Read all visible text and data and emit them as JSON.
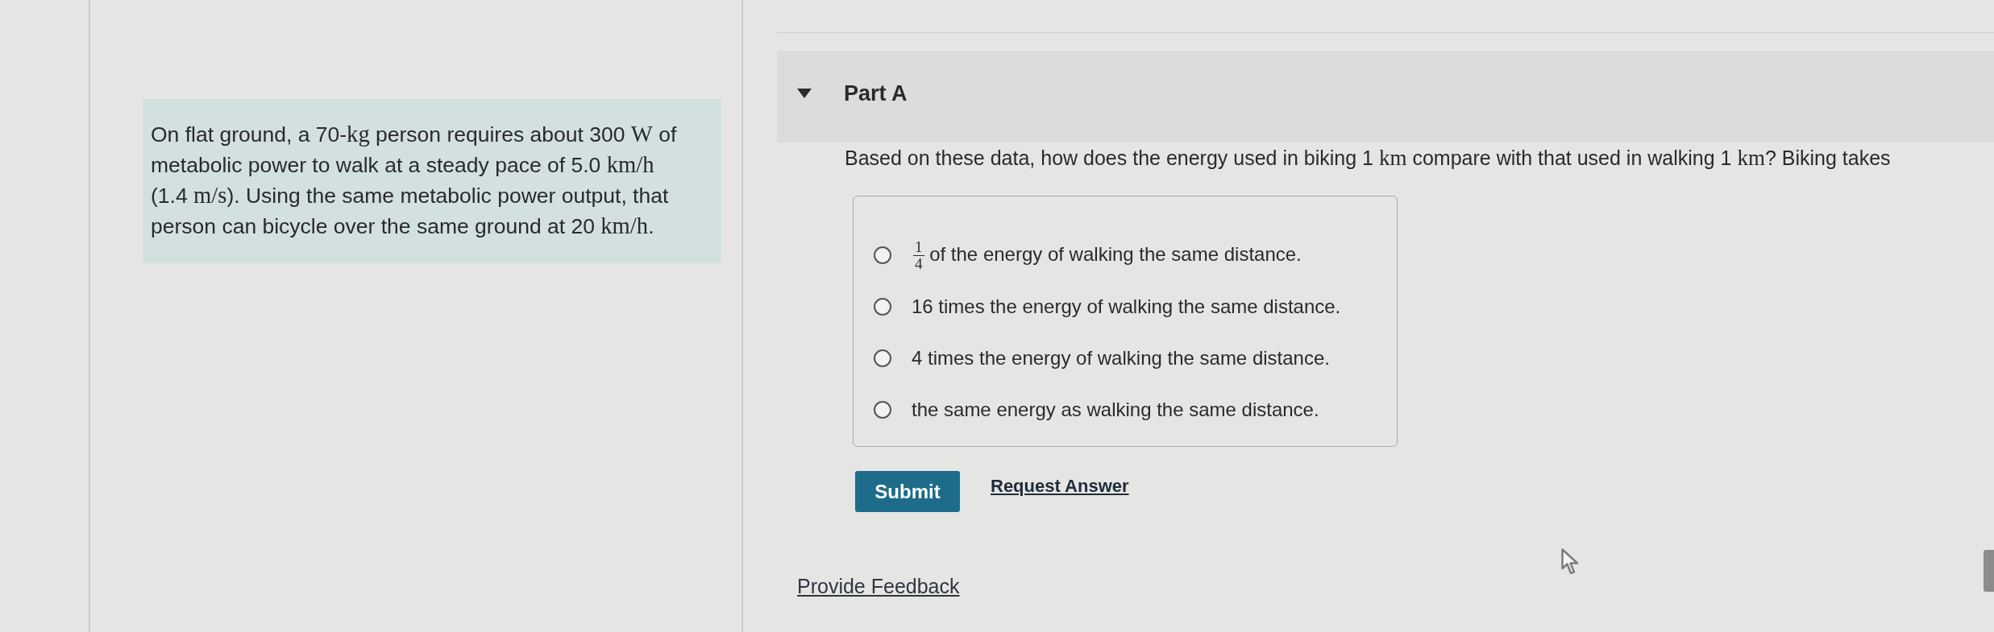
{
  "problem": {
    "segments": [
      {
        "kind": "text",
        "text": "On flat ground, a 70-"
      },
      {
        "kind": "math",
        "text": "kg"
      },
      {
        "kind": "text",
        "text": " person requires about 300 "
      },
      {
        "kind": "math",
        "text": "W"
      },
      {
        "kind": "text",
        "text": " of metabolic power to walk at a steady pace of 5.0 "
      },
      {
        "kind": "math",
        "text": "km/h"
      },
      {
        "kind": "text",
        "text": " (1.4 "
      },
      {
        "kind": "math",
        "text": "m/s"
      },
      {
        "kind": "text",
        "text": "). Using the same metabolic power output, that person can bicycle over the same ground at 20 "
      },
      {
        "kind": "math",
        "text": "km/h"
      },
      {
        "kind": "text",
        "text": "."
      }
    ]
  },
  "part": {
    "title": "Part A",
    "expanded": true
  },
  "question": {
    "segments": [
      {
        "kind": "text",
        "text": "Based on these data, how does the energy used in biking 1 "
      },
      {
        "kind": "math",
        "text": "km"
      },
      {
        "kind": "text",
        "text": " compare with that used in walking 1 "
      },
      {
        "kind": "math",
        "text": "km"
      },
      {
        "kind": "text",
        "text": "? Biking takes"
      }
    ]
  },
  "options": [
    {
      "selected": false,
      "segments": [
        {
          "kind": "fraction",
          "numerator": "1",
          "denominator": "4"
        },
        {
          "kind": "text",
          "text": " of the energy of walking the same distance."
        }
      ]
    },
    {
      "selected": false,
      "segments": [
        {
          "kind": "text",
          "text": "16 times the energy of walking the same distance."
        }
      ]
    },
    {
      "selected": false,
      "segments": [
        {
          "kind": "text",
          "text": "4 times the energy of walking the same distance."
        }
      ]
    },
    {
      "selected": false,
      "segments": [
        {
          "kind": "text",
          "text": "the same energy as walking the same distance."
        }
      ]
    }
  ],
  "actions": {
    "submit": "Submit",
    "request_answer": "Request Answer"
  },
  "feedback_link": "Provide Feedback"
}
